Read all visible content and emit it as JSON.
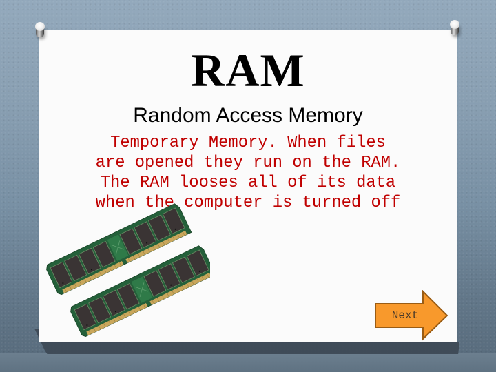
{
  "slide": {
    "title": "RAM",
    "subtitle": "Random Access Memory",
    "body_lines": [
      "Temporary Memory. When files",
      "are opened they run on the RAM.",
      "The RAM looses all of its data",
      "when the computer is turned off"
    ],
    "image": {
      "description": "Two RAM memory modules (DIMM sticks)",
      "icon": "ram-module-icon"
    }
  },
  "navigation": {
    "next_label": "Next",
    "next_icon": "right-arrow-icon"
  },
  "colors": {
    "background_top": "#93a9bc",
    "background_bottom": "#56697a",
    "paper": "#fbfbfb",
    "title_text": "#000000",
    "body_text": "#c00000",
    "arrow_fill": "#f8992c",
    "arrow_border": "#9a5c14",
    "pcb_green": "#24603a",
    "chip": "#3a3434",
    "contacts_gold": "#c9a75c"
  },
  "decorations": {
    "pins": [
      "pushpin-icon",
      "pushpin-icon"
    ]
  }
}
